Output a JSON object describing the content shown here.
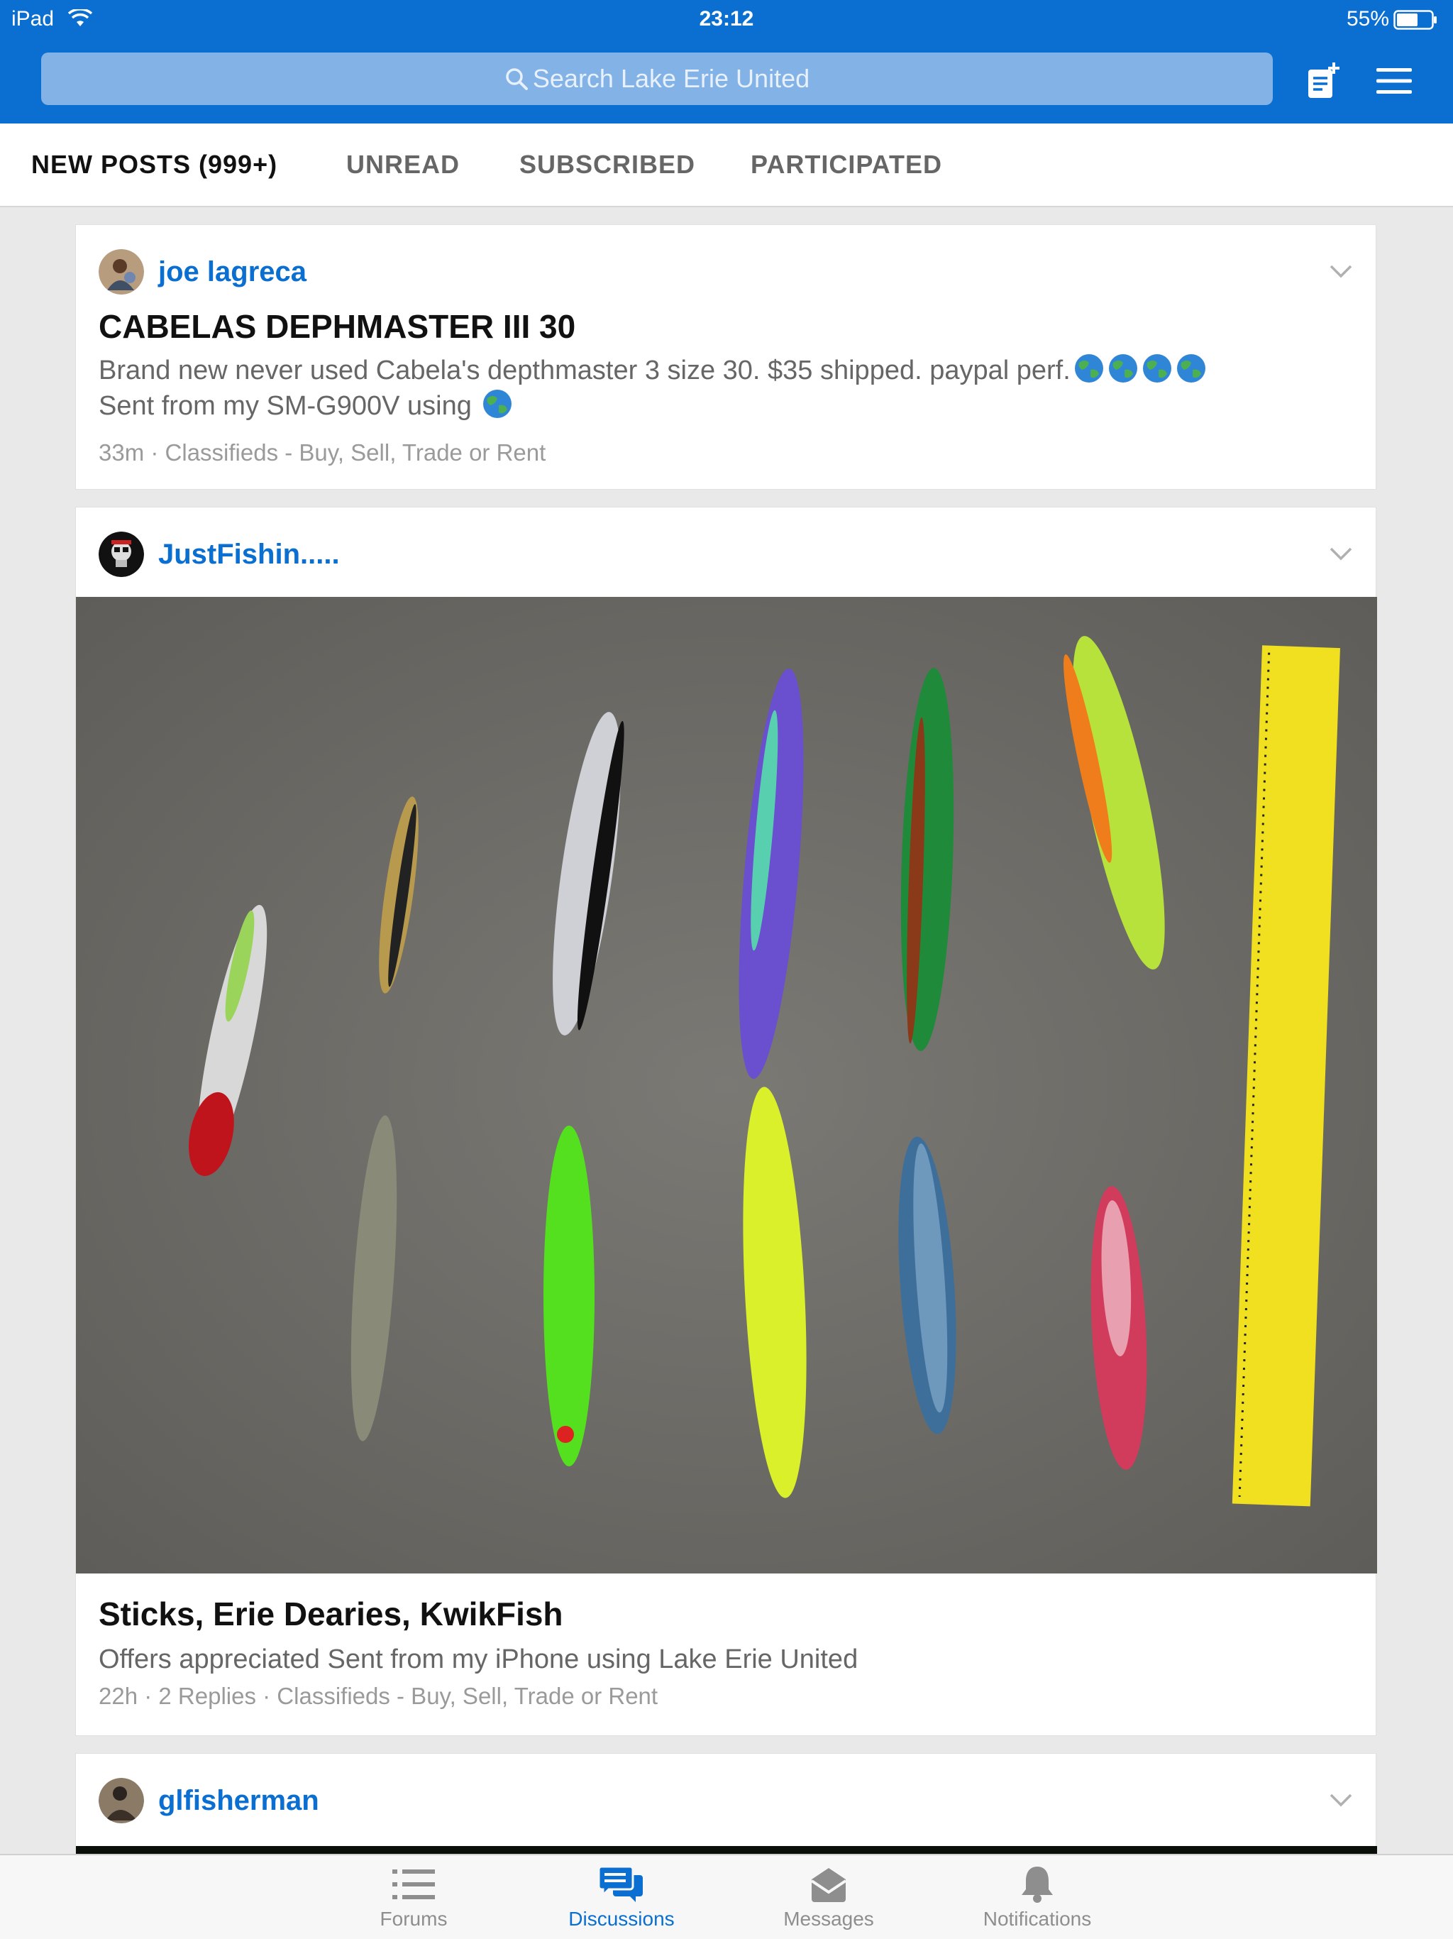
{
  "status_bar": {
    "device": "iPad",
    "time": "23:12",
    "battery": "55%"
  },
  "search": {
    "placeholder": "Search Lake Erie United"
  },
  "tabs": [
    {
      "label": "NEW POSTS (999+)",
      "active": true
    },
    {
      "label": "UNREAD",
      "active": false
    },
    {
      "label": "SUBSCRIBED",
      "active": false
    },
    {
      "label": "PARTICIPATED",
      "active": false
    }
  ],
  "posts": [
    {
      "author": "joe lagreca",
      "title": "CABELAS DEPHMASTER III 30",
      "snippet_line1": "Brand new never used Cabela's depthmaster 3 size 30. $35 shipped. paypal perf.",
      "snippet_line2": "Sent from my SM-G900V using",
      "time": "33m",
      "replies": "",
      "forum": "Classifieds - Buy, Sell, Trade or Rent"
    },
    {
      "author": "JustFishin.....",
      "title": "Sticks, Erie Dearies, KwikFish",
      "snippet": "Offers appreciated Sent from my iPhone using Lake Erie United",
      "time": "22h",
      "replies": "2 Replies",
      "forum": "Classifieds - Buy, Sell, Trade or Rent"
    },
    {
      "author": "glfisherman"
    }
  ],
  "bottom_nav": [
    {
      "label": "Forums",
      "icon": "list-icon",
      "active": false
    },
    {
      "label": "Discussions",
      "icon": "chat-bubbles-icon",
      "active": true
    },
    {
      "label": "Messages",
      "icon": "envelope-icon",
      "active": false
    },
    {
      "label": "Notifications",
      "icon": "bell-icon",
      "active": false
    }
  ],
  "colors": {
    "brand_blue": "#0a6fd0",
    "search_bg": "#82b2e6",
    "page_bg": "#e9e9e9"
  }
}
